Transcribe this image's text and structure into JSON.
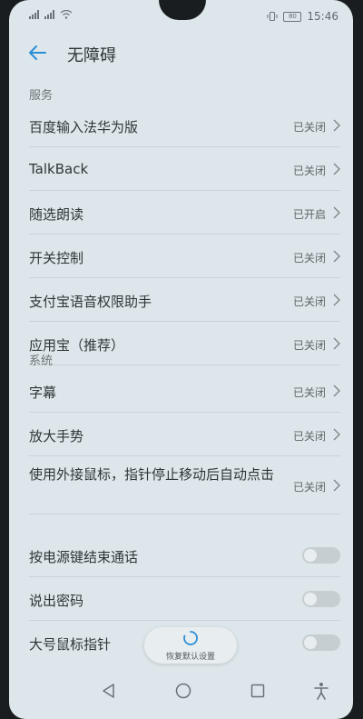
{
  "statusbar": {
    "left_text": "",
    "time": "15:46",
    "battery": "80"
  },
  "header": {
    "title": "无障碍"
  },
  "sections": {
    "services": "服务",
    "system": "系统"
  },
  "items": [
    {
      "label": "百度输入法华为版",
      "status": "已关闭"
    },
    {
      "label": "TalkBack",
      "status": "已关闭"
    },
    {
      "label": "随选朗读",
      "status": "已开启"
    },
    {
      "label": "开关控制",
      "status": "已关闭"
    },
    {
      "label": "支付宝语音权限助手",
      "status": "已关闭"
    },
    {
      "label": "应用宝（推荐）",
      "status": "已关闭"
    },
    {
      "label": "字幕",
      "status": "已关闭"
    },
    {
      "label": "放大手势",
      "status": "已关闭"
    },
    {
      "label": "使用外接鼠标，指针停止移动后自动点击",
      "status": "已关闭"
    },
    {
      "label": "按电源键结束通话"
    },
    {
      "label": "说出密码"
    },
    {
      "label": "大号鼠标指针"
    }
  ],
  "reset_button": {
    "label": "恢复默认设置"
  },
  "colors": {
    "background": "#dde6ea",
    "accent": "#2a8fd6",
    "divider": "#c9d2d6"
  }
}
